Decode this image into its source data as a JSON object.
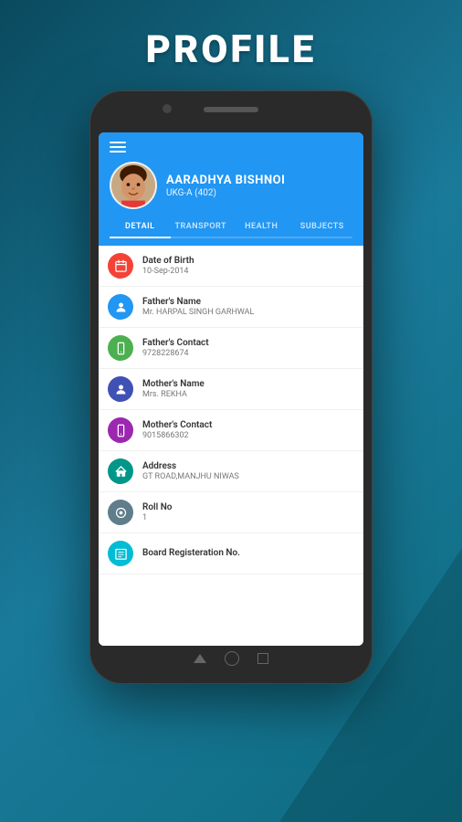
{
  "page": {
    "title": "PROFILE"
  },
  "phone": {
    "student": {
      "name": "AARADHYA BISHNOI",
      "class": "UKG-A (402)"
    },
    "tabs": [
      {
        "label": "DETAIL",
        "active": true
      },
      {
        "label": "TRANSPORT",
        "active": false
      },
      {
        "label": "HEALTH",
        "active": false
      },
      {
        "label": "SUBJECTS",
        "active": false
      }
    ],
    "details": [
      {
        "icon": "📅",
        "icon_color": "#f44336",
        "label": "Date of Birth",
        "value": "10-Sep-2014"
      },
      {
        "icon": "👤",
        "icon_color": "#2196f3",
        "label": "Father's Name",
        "value": "Mr. HARPAL SINGH GARHWAL"
      },
      {
        "icon": "📱",
        "icon_color": "#4caf50",
        "label": "Father's Contact",
        "value": "9728228674"
      },
      {
        "icon": "👤",
        "icon_color": "#3f51b5",
        "label": "Mother's Name",
        "value": "Mrs. REKHA"
      },
      {
        "icon": "📱",
        "icon_color": "#9c27b0",
        "label": "Mother's Contact",
        "value": "9015866302"
      },
      {
        "icon": "🏠",
        "icon_color": "#009688",
        "label": "Address",
        "value": "GT ROAD,MANJHU NIWAS"
      },
      {
        "icon": "⊛",
        "icon_color": "#607d8b",
        "label": "Roll No",
        "value": "1"
      },
      {
        "icon": "📋",
        "icon_color": "#00bcd4",
        "label": "Board Registeration No.",
        "value": ""
      }
    ],
    "icons": {
      "calendar": "📅",
      "person": "👤",
      "phone": "📱",
      "home": "🏠"
    }
  }
}
